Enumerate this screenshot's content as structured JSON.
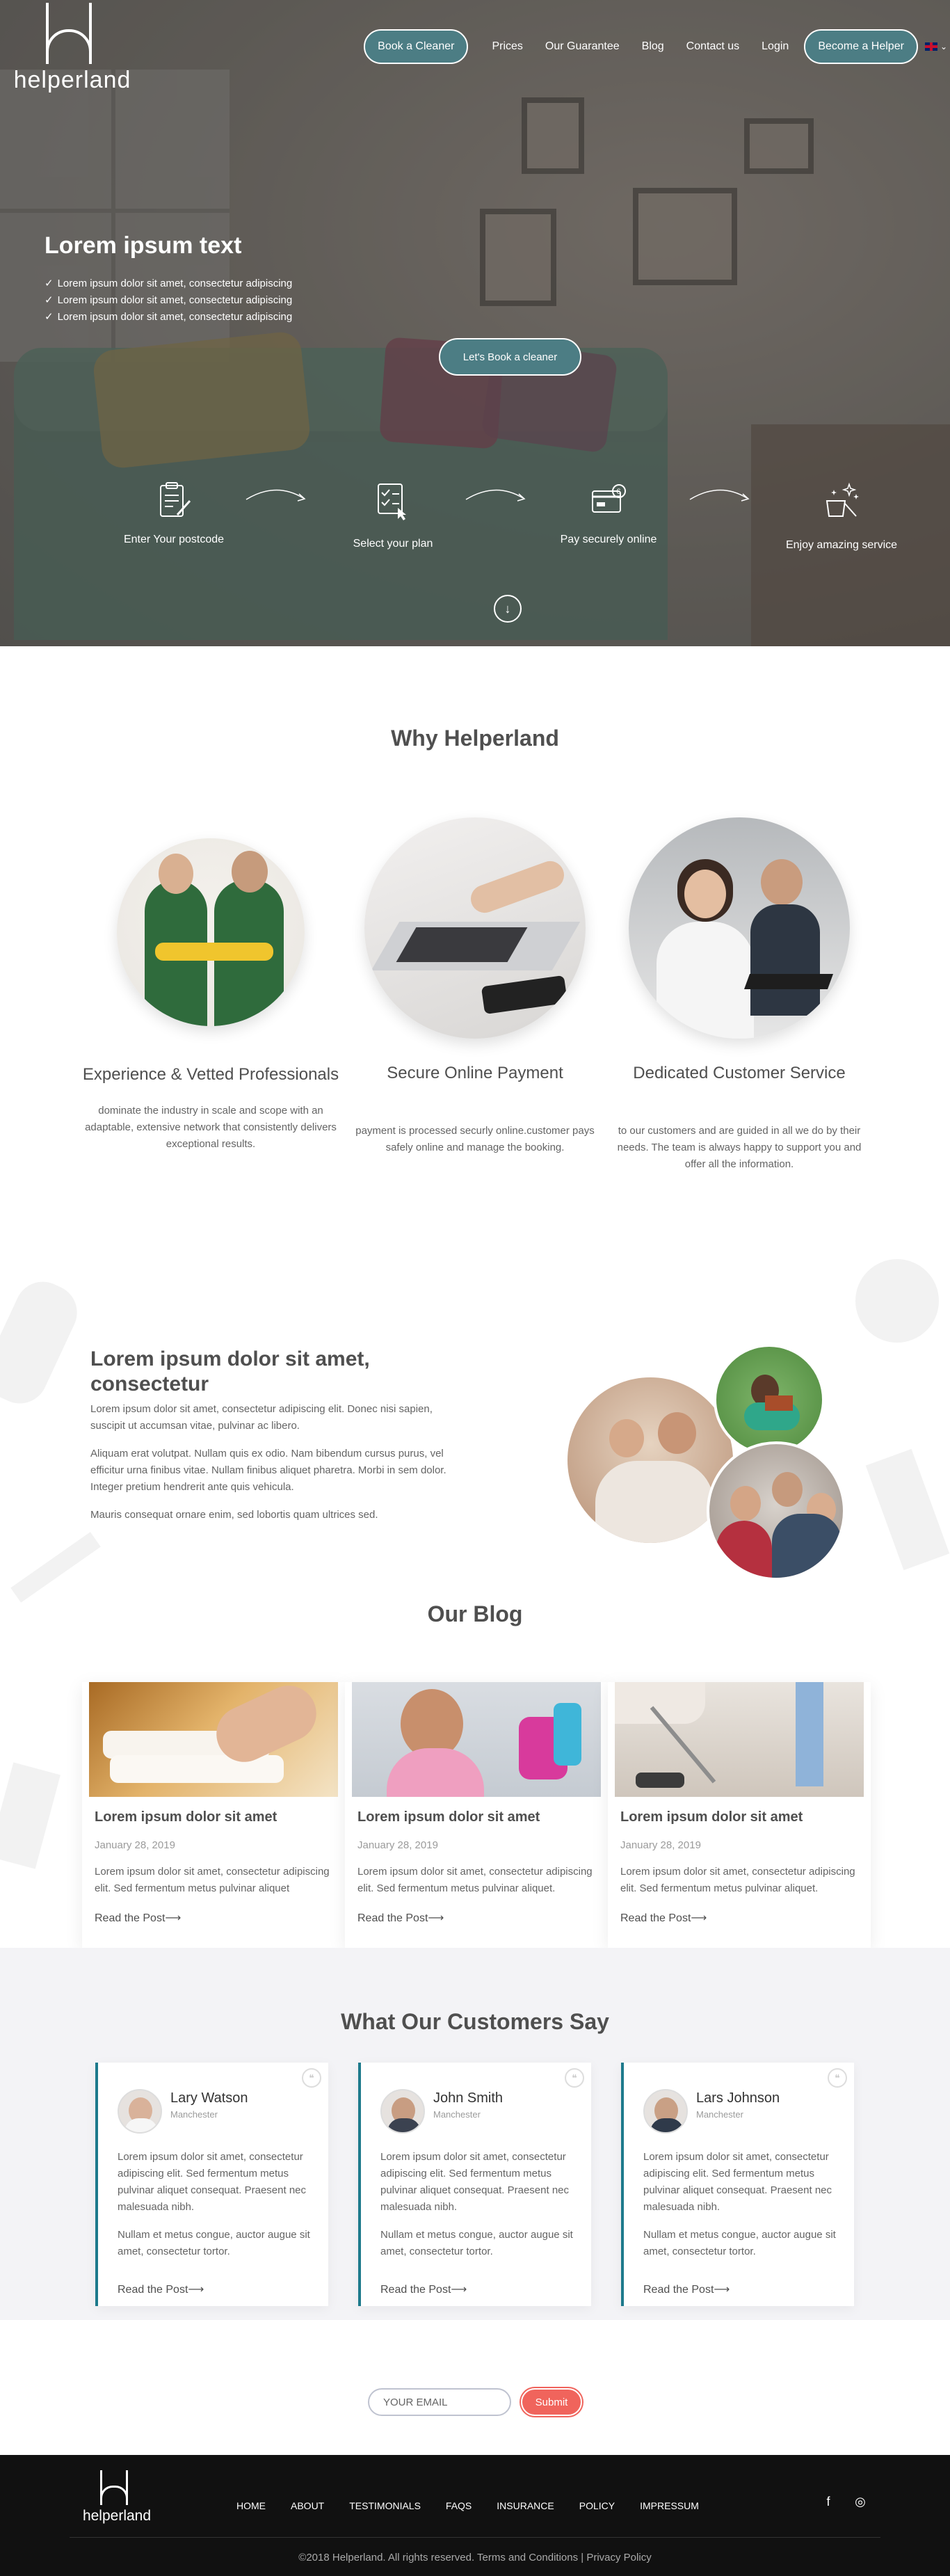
{
  "nav": {
    "logo_text": "helperland",
    "book_button": "Book a Cleaner",
    "links": [
      "Prices",
      "Our Guarantee",
      "Blog",
      "Contact us",
      "Login"
    ],
    "helper_button": "Become a Helper",
    "language_caret": "⌄"
  },
  "hero": {
    "title": "Lorem ipsum text",
    "bullets": [
      "Lorem ipsum dolor sit amet, consectetur adipiscing",
      "Lorem ipsum dolor sit amet, consectetur adipiscing",
      "Lorem ipsum dolor sit amet, consectetur adipiscing"
    ],
    "check_glyph": "✓",
    "cta": "Let's Book a cleaner",
    "steps": [
      {
        "label": "Enter Your postcode",
        "icon": "clipboard-pen-icon"
      },
      {
        "label": "Select your plan",
        "icon": "checklist-cursor-icon"
      },
      {
        "label": "Pay securely online",
        "icon": "card-payment-icon"
      },
      {
        "label": "Enjoy amazing service",
        "icon": "cleaning-sparkle-icon"
      }
    ],
    "down_glyph": "↓"
  },
  "why": {
    "title": "Why Helperland",
    "cards": [
      {
        "title": "Experience & Vetted Professionals",
        "text": "dominate the industry in scale and scope with an adaptable, extensive network that consistently delivers exceptional results."
      },
      {
        "title": "Secure Online Payment",
        "text": "payment is processed securly online.customer pays safely online and manage the booking."
      },
      {
        "title": "Dedicated Customer Service",
        "text": "to our customers and are guided in all we do by their needs. The team is always happy to support you and offer all the information."
      }
    ]
  },
  "lorem": {
    "title": "Lorem ipsum dolor sit amet, consectetur",
    "paragraphs": [
      "Lorem ipsum dolor sit amet, consectetur adipiscing elit. Donec nisi sapien, suscipit ut accumsan vitae, pulvinar ac libero.",
      "Aliquam erat volutpat. Nullam quis ex odio. Nam bibendum cursus purus, vel efficitur urna finibus vitae. Nullam finibus aliquet pharetra. Morbi in sem dolor. Integer pretium hendrerit ante quis vehicula.",
      "Mauris consequat ornare enim, sed lobortis quam ultrices sed."
    ]
  },
  "blog": {
    "title": "Our Blog",
    "posts": [
      {
        "title": "Lorem ipsum dolor sit amet",
        "date": "January 28, 2019",
        "text": "Lorem ipsum dolor sit amet, consectetur adipiscing elit. Sed fermentum metus pulvinar aliquet",
        "read": "Read the Post⟶"
      },
      {
        "title": "Lorem ipsum dolor sit amet",
        "date": "January 28, 2019",
        "text": "Lorem ipsum dolor sit amet, consectetur adipiscing elit. Sed fermentum metus pulvinar aliquet.",
        "read": "Read the Post⟶"
      },
      {
        "title": "Lorem ipsum dolor sit amet",
        "date": "January 28, 2019",
        "text": "Lorem ipsum dolor sit amet, consectetur adipiscing elit. Sed fermentum metus pulvinar aliquet.",
        "read": "Read the Post⟶"
      }
    ]
  },
  "testimonials": {
    "title": "What Our Customers Say",
    "quote_glyph": "❝",
    "items": [
      {
        "name": "Lary Watson",
        "city": "Manchester",
        "p1": "Lorem ipsum dolor sit amet, consectetur adipiscing elit. Sed fermentum metus pulvinar aliquet consequat. Praesent nec malesuada nibh.",
        "p2": "Nullam et metus congue, auctor augue sit amet, consectetur tortor.",
        "read": "Read the Post⟶"
      },
      {
        "name": "John Smith",
        "city": "Manchester",
        "p1": "Lorem ipsum dolor sit amet, consectetur adipiscing elit. Sed fermentum metus pulvinar aliquet consequat. Praesent nec malesuada nibh.",
        "p2": "Nullam et metus congue, auctor augue sit amet, consectetur tortor.",
        "read": "Read the Post⟶"
      },
      {
        "name": "Lars Johnson",
        "city": "Manchester",
        "p1": "Lorem ipsum dolor sit amet, consectetur adipiscing elit. Sed fermentum metus pulvinar aliquet consequat. Praesent nec malesuada nibh.",
        "p2": "Nullam et metus congue, auctor augue sit amet, consectetur tortor.",
        "read": "Read the Post⟶"
      }
    ]
  },
  "newsletter": {
    "placeholder": "YOUR EMAIL",
    "submit": "Submit"
  },
  "footer": {
    "logo_text": "helperland",
    "links": [
      "HOME",
      "ABOUT",
      "TESTIMONIALS",
      "FAQS",
      "INSURANCE",
      "POLICY",
      "IMPRESSUM"
    ],
    "facebook_glyph": "f",
    "instagram_glyph": "◎",
    "copyright": "©2018 Helperland. All rights reserved. Terms and Conditions | Privacy Policy"
  },
  "colors": {
    "accent_teal": "#4c7d84",
    "testimonial_border": "#1d7a8c",
    "submit_red": "#f0645c",
    "footer_bg": "#111111",
    "testimonial_bg": "#f3f3f6"
  }
}
